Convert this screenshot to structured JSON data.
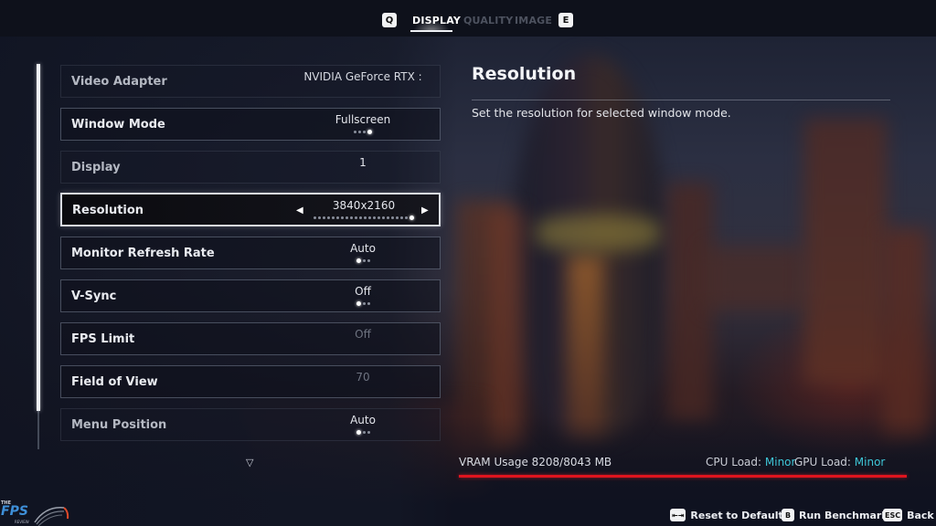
{
  "tabs": {
    "prev_key": "Q",
    "next_key": "E",
    "items": [
      {
        "label": "DISPLAY",
        "active": true
      },
      {
        "label": "QUALITY",
        "active": false
      },
      {
        "label": "IMAGE",
        "active": false
      }
    ]
  },
  "settings": [
    {
      "label": "Video Adapter",
      "value": "NVIDIA GeForce RTX :",
      "state": "disabled"
    },
    {
      "label": "Window Mode",
      "value": "Fullscreen",
      "options_count": 4,
      "selected_index": 3
    },
    {
      "label": "Display",
      "value": "1",
      "state": "disabled"
    },
    {
      "label": "Resolution",
      "value": "3840x2160",
      "state": "selected",
      "options_count": 22,
      "selected_index": 21,
      "prev_icon": "◀",
      "next_icon": "▶"
    },
    {
      "label": "Monitor Refresh Rate",
      "value": "Auto",
      "options_count": 3,
      "selected_index": 0
    },
    {
      "label": "V-Sync",
      "value": "Off",
      "options_count": 3,
      "selected_index": 0
    },
    {
      "label": "FPS Limit",
      "value": "Off",
      "value_state": "dim"
    },
    {
      "label": "Field of View",
      "value": "70",
      "value_state": "dim"
    },
    {
      "label": "Menu Position",
      "value": "Auto",
      "state": "disabled",
      "options_count": 3,
      "selected_index": 0
    }
  ],
  "more_indicator": "▽",
  "scroll": {
    "visible_fraction": 0.9,
    "position": 0.0
  },
  "detail": {
    "title": "Resolution",
    "description": "Set the resolution for selected window mode."
  },
  "status": {
    "vram_label": "VRAM Usage 8208/8043 MB",
    "vram_used_mb": 8208,
    "vram_total_mb": 8043,
    "vram_bar_color": "#e0141e",
    "cpu_label": "CPU Load:",
    "cpu_value": "Minor",
    "gpu_label": "GPU Load:",
    "gpu_value": "Minor",
    "load_value_color": "#3ec5d6"
  },
  "footer": {
    "reset_key": "⇤⇥",
    "reset_label": "Reset to Defaults",
    "benchmark_key": "B",
    "benchmark_label": "Run Benchmark",
    "back_key": "ESC",
    "back_label": "Back"
  },
  "watermark": {
    "the": "THE",
    "fps": "FPS",
    "review": "REVIEW"
  }
}
